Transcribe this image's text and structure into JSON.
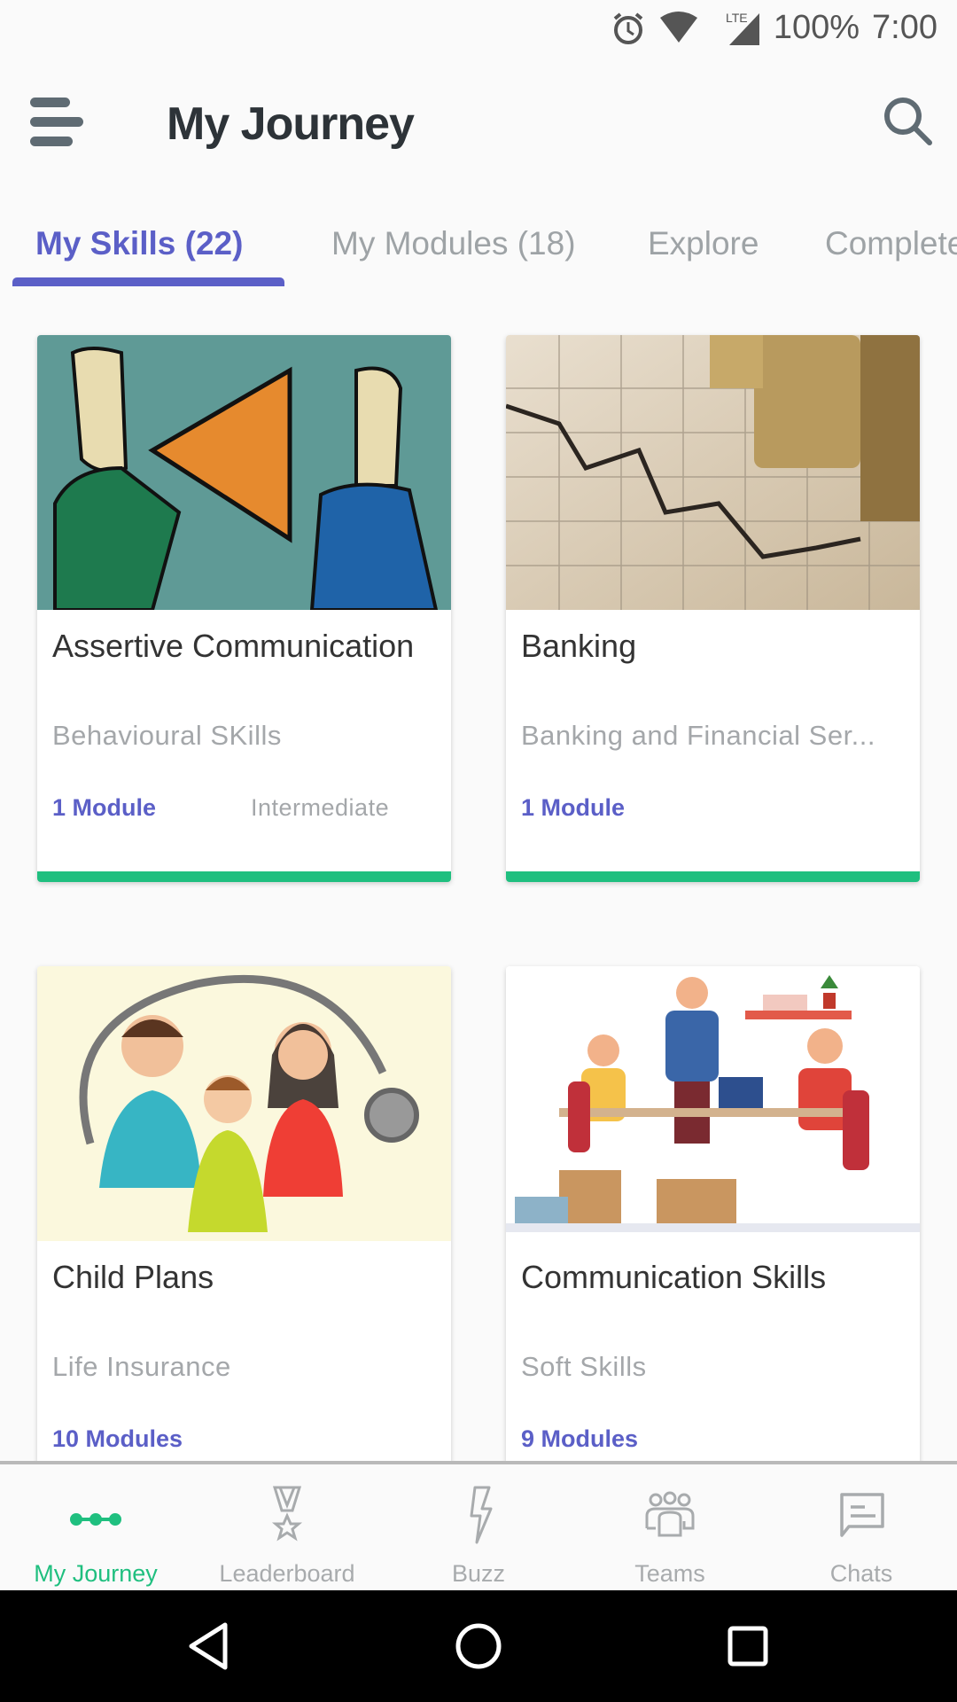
{
  "status_bar": {
    "battery": "100%",
    "time": "7:00",
    "network": "LTE",
    "icons": [
      "alarm-icon",
      "wifi-icon",
      "lte-signal-icon"
    ]
  },
  "app_bar": {
    "title": "My Journey",
    "menu_icon": "hamburger-icon",
    "search_icon": "search-icon"
  },
  "tabs": [
    {
      "label": "My Skills (22)",
      "active": true
    },
    {
      "label": "My Modules (18)",
      "active": false
    },
    {
      "label": "Explore",
      "active": false
    },
    {
      "label": "Completed",
      "active": false
    }
  ],
  "cards": [
    {
      "title": "Assertive Communication",
      "category": "Behavioural SKills",
      "modules": "1 Module",
      "level": "Intermediate",
      "progress": 100,
      "image": "megaphone-illustration"
    },
    {
      "title": "Banking",
      "category": "Banking and Financial Ser...",
      "modules": "1 Module",
      "level": "",
      "progress": 100,
      "image": "coins-chart-photo"
    },
    {
      "title": "Child Plans",
      "category": "Life Insurance",
      "modules": "10 Modules",
      "level": "",
      "image": "family-stethoscope-illustration"
    },
    {
      "title": "Communication Skills",
      "category": "Soft Skills",
      "modules": "9 Modules",
      "level": "",
      "image": "office-team-illustration"
    }
  ],
  "bottom_nav": [
    {
      "label": "My Journey",
      "icon": "journey-dots-icon",
      "active": true
    },
    {
      "label": "Leaderboard",
      "icon": "medal-icon",
      "active": false
    },
    {
      "label": "Buzz",
      "icon": "lightning-icon",
      "active": false
    },
    {
      "label": "Teams",
      "icon": "team-icon",
      "active": false
    },
    {
      "label": "Chats",
      "icon": "chat-icon",
      "active": false
    }
  ],
  "colors": {
    "accent": "#5b5fc7",
    "green": "#1fbf7f",
    "title": "#2d3338",
    "muted": "#a4a7aa"
  }
}
